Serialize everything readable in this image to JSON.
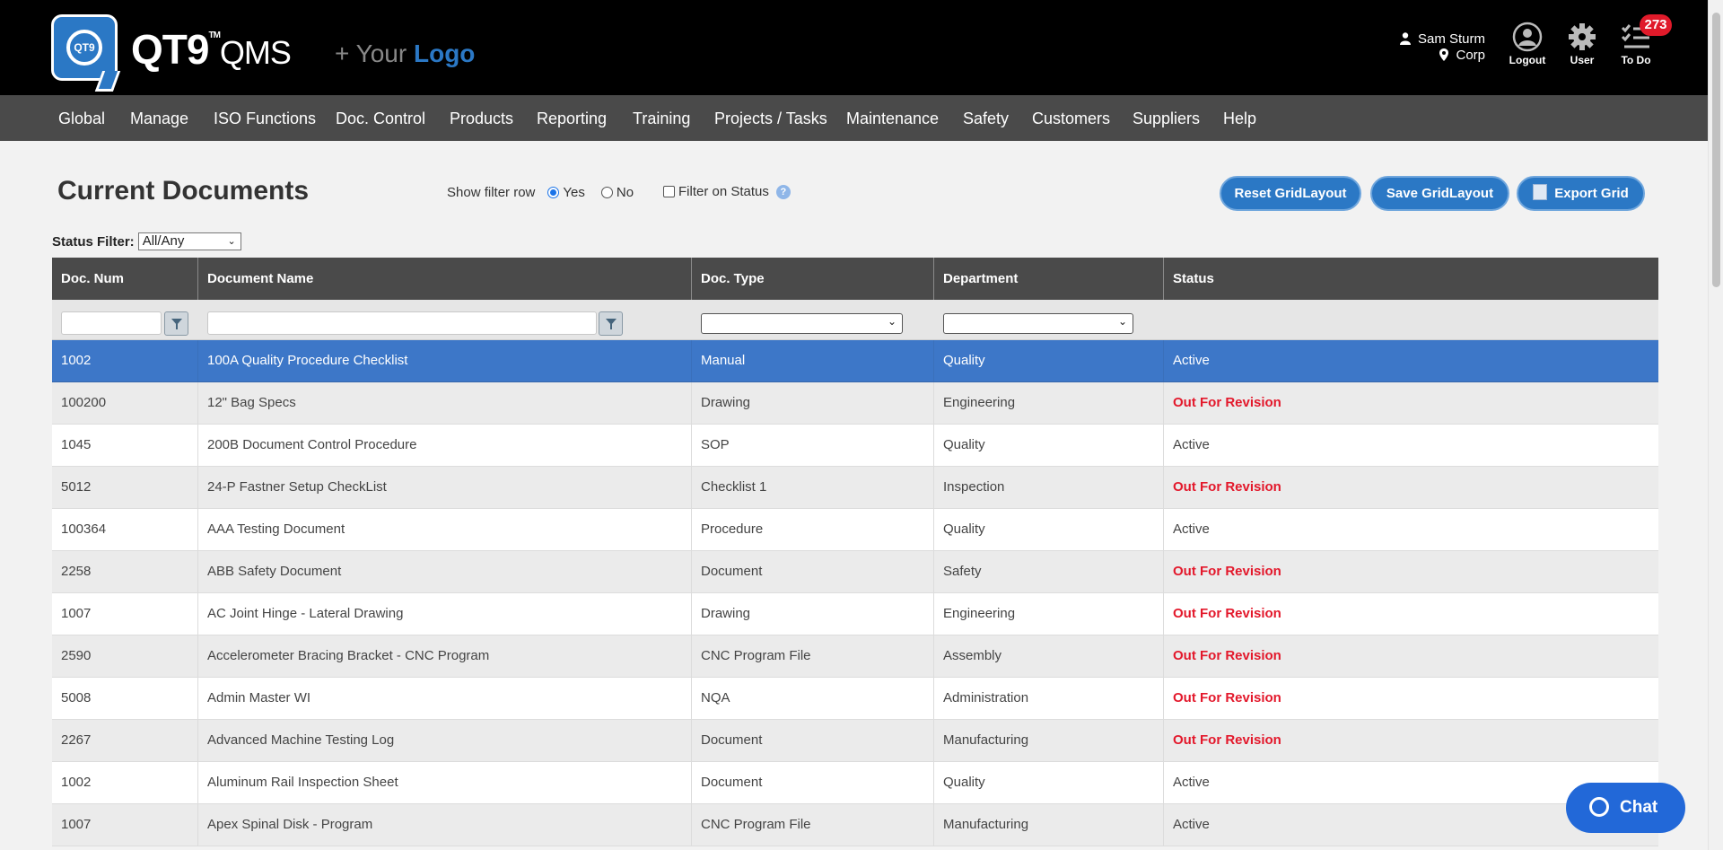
{
  "header": {
    "logo_badge_text": "QT9",
    "logo_text": "QT9",
    "logo_tm": "TM",
    "logo_qms": "QMS",
    "your_logo_prefix": "+ Your",
    "your_logo_word": "Logo",
    "user_name": "Sam Sturm",
    "user_location": "Corp",
    "logout_label": "Logout",
    "user_label": "User",
    "todo_label": "To Do",
    "todo_count": "273"
  },
  "nav": {
    "items": [
      "Global",
      "Manage",
      "ISO Functions",
      "Doc. Control",
      "Products",
      "Reporting",
      "Training",
      "Projects / Tasks",
      "Maintenance",
      "Safety",
      "Customers",
      "Suppliers",
      "Help"
    ]
  },
  "toolbar": {
    "title": "Current Documents",
    "show_filter_row_label": "Show filter row",
    "yes_label": "Yes",
    "no_label": "No",
    "show_filter_row_value": "Yes",
    "filter_on_status_label": "Filter on Status",
    "help_glyph": "?",
    "reset_label": "Reset GridLayout",
    "save_label": "Save GridLayout",
    "export_label": "Export Grid",
    "status_filter_label": "Status Filter:",
    "status_filter_value": "All/Any"
  },
  "grid": {
    "columns": [
      "Doc. Num",
      "Document Name",
      "Doc. Type",
      "Department",
      "Status"
    ],
    "rows": [
      [
        "1002",
        "100A Quality Procedure Checklist",
        "Manual",
        "Quality",
        "Active"
      ],
      [
        "100200",
        "12\" Bag Specs",
        "Drawing",
        "Engineering",
        "Out For Revision"
      ],
      [
        "1045",
        "200B Document Control Procedure",
        "SOP",
        "Quality",
        "Active"
      ],
      [
        "5012",
        "24-P Fastner Setup CheckList",
        "Checklist 1",
        "Inspection",
        "Out For Revision"
      ],
      [
        "100364",
        "AAA Testing Document",
        "Procedure",
        "Quality",
        "Active"
      ],
      [
        "2258",
        "ABB Safety Document",
        "Document",
        "Safety",
        "Out For Revision"
      ],
      [
        "1007",
        "AC Joint Hinge - Lateral Drawing",
        "Drawing",
        "Engineering",
        "Out For Revision"
      ],
      [
        "2590",
        "Accelerometer Bracing Bracket - CNC Program",
        "CNC Program File",
        "Assembly",
        "Out For Revision"
      ],
      [
        "5008",
        "Admin Master WI",
        "NQA",
        "Administration",
        "Out For Revision"
      ],
      [
        "2267",
        "Advanced Machine Testing Log",
        "Document",
        "Manufacturing",
        "Out For Revision"
      ],
      [
        "1002",
        "Aluminum Rail Inspection Sheet",
        "Document",
        "Quality",
        "Active"
      ],
      [
        "1007",
        "Apex Spinal Disk - Program",
        "CNC Program File",
        "Manufacturing",
        "Active"
      ]
    ]
  },
  "chat": {
    "label": "Chat"
  },
  "colors": {
    "accent": "#2b78c5",
    "selected_row": "#3d77c8",
    "revision": "#e3182b",
    "nav": "#4a4a4a"
  }
}
